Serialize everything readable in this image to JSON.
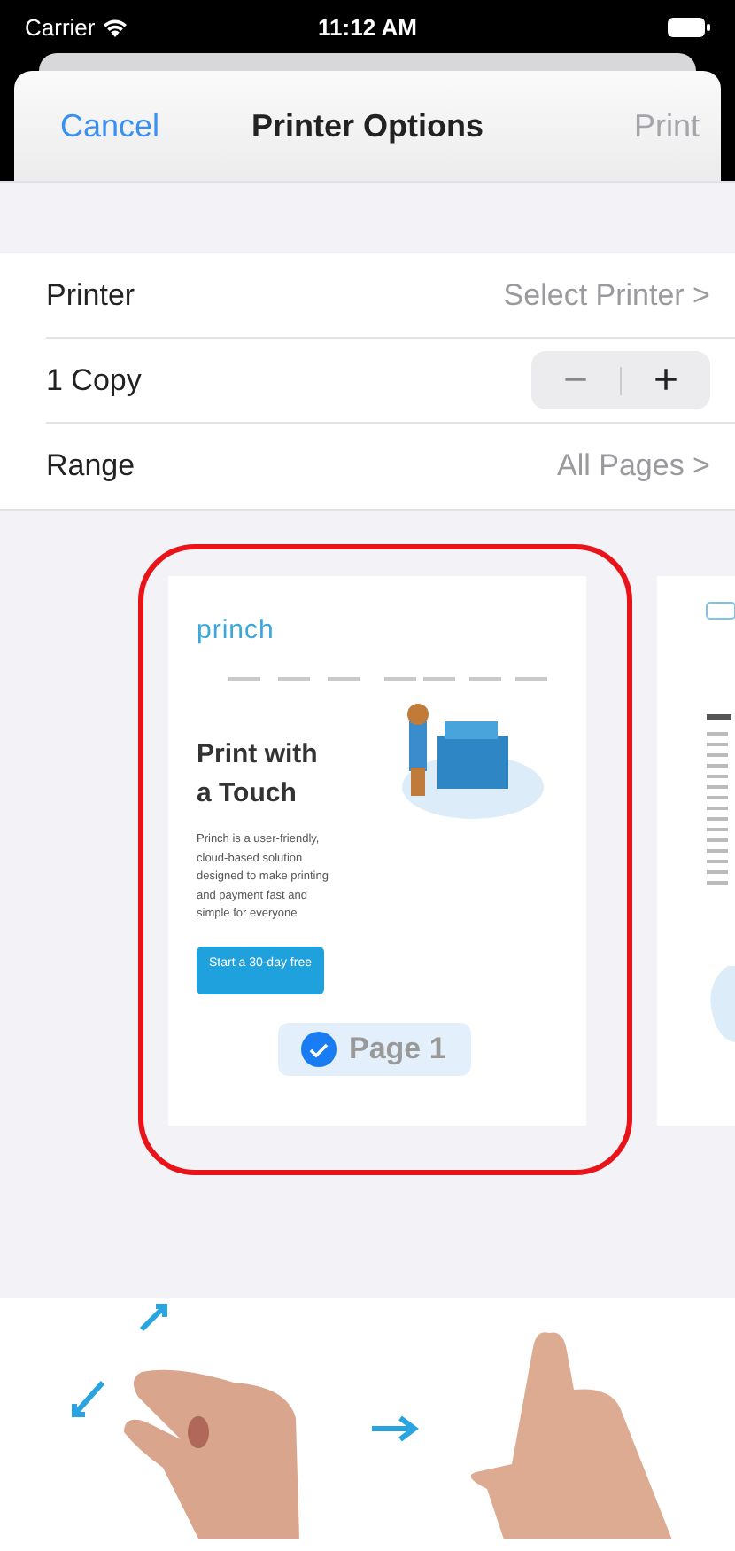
{
  "status_bar": {
    "carrier": "Carrier",
    "time": "11:12 AM"
  },
  "nav_bar": {
    "cancel": "Cancel",
    "title": "Printer Options",
    "print": "Print",
    "print_disabled": true
  },
  "options": [
    {
      "kind": "link",
      "label": "Printer",
      "value": "Select Printer",
      "chevron": ">"
    },
    {
      "kind": "stepper",
      "label": "1 Copy",
      "minus": "−",
      "plus": "+"
    },
    {
      "kind": "link",
      "label": "Range",
      "value": "All Pages",
      "chevron": ">"
    }
  ],
  "preview": {
    "page": {
      "label": "Page 1",
      "selected": true,
      "logo": "princh",
      "headline": "Print with a Touch",
      "body": "Princh is a user-friendly, cloud-based solution designed to make printing and payment fast and simple for everyone",
      "cta": "Start a 30-day free"
    }
  }
}
